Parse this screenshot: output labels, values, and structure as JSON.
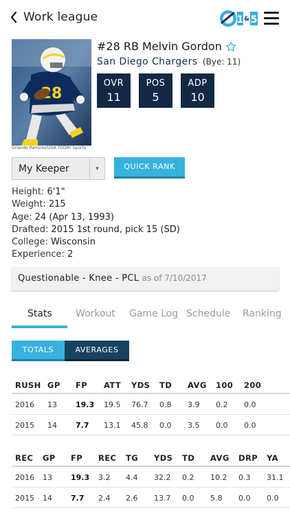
{
  "header": {
    "back_label": "Work league",
    "logo_text": "1st & 5"
  },
  "player": {
    "name": "#28 RB Melvin Gordon",
    "team": "San Diego Chargers",
    "bye": "(Bye: 11)",
    "photo_credit": "Orlando Ramirez/USA TODAY Sports",
    "jersey_number": "28",
    "boxes": [
      {
        "label": "OVR",
        "value": "11"
      },
      {
        "label": "POS",
        "value": "5"
      },
      {
        "label": "ADP",
        "value": "10"
      }
    ]
  },
  "keeper": {
    "selected": "My Keeper",
    "arrow": "▾"
  },
  "quick_rank_label": "QUICK RANK",
  "bio": [
    {
      "label": "Height: ",
      "value": "6'1\""
    },
    {
      "label": "Weight: ",
      "value": "215"
    },
    {
      "label": "Age: ",
      "value": "24 (Apr 13, 1993)"
    },
    {
      "label": "Drafted: ",
      "value": "2015 1st round, pick 15 (SD)"
    },
    {
      "label": "College: ",
      "value": "Wisconsin"
    },
    {
      "label": "Experience: ",
      "value": "2"
    }
  ],
  "injury": {
    "status": "Questionable - Knee - PCL",
    "as_of": "as of 7/10/2017"
  },
  "tabs": [
    "Stats",
    "Workout",
    "Game Log",
    "Schedule",
    "Ranking"
  ],
  "toggle": {
    "totals": "TOTALS",
    "averages": "AVERAGES"
  },
  "rush_table": {
    "headers": [
      "RUSH",
      "GP",
      "FP",
      "ATT",
      "YDS",
      "TD",
      "AVG",
      "100",
      "200"
    ],
    "rows": [
      [
        "2016",
        "13",
        "19.3",
        "19.5",
        "76.7",
        "0.8",
        "3.9",
        "0.2",
        "0.0"
      ],
      [
        "2015",
        "14",
        "7.7",
        "13.1",
        "45.8",
        "0.0",
        "3.5",
        "0.0",
        "0.0"
      ]
    ]
  },
  "rec_table": {
    "headers": [
      "REC",
      "GP",
      "FP",
      "REC",
      "TG",
      "YDS",
      "TD",
      "AVG",
      "DRP",
      "YA"
    ],
    "rows": [
      [
        "2016",
        "13",
        "19.3",
        "3.2",
        "4.4",
        "32.2",
        "0.2",
        "10.2",
        "0.3",
        "31.1"
      ],
      [
        "2015",
        "14",
        "7.7",
        "2.4",
        "2.6",
        "13.7",
        "0.0",
        "5.8",
        "0.0",
        "0.0"
      ]
    ]
  }
}
